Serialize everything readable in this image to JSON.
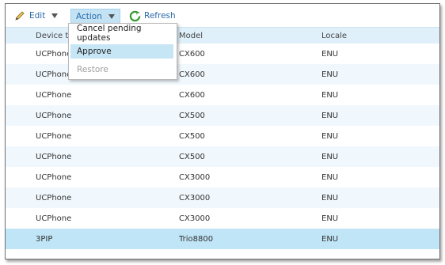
{
  "toolbar": {
    "edit_label": "Edit",
    "action_label": "Action",
    "refresh_label": "Refresh"
  },
  "menu": {
    "items": [
      {
        "label": "Cancel pending updates",
        "state": "normal"
      },
      {
        "label": "Approve",
        "state": "hover"
      },
      {
        "label": "Restore",
        "state": "disabled"
      }
    ]
  },
  "table": {
    "columns": [
      "Device type",
      "Model",
      "Locale"
    ],
    "rows": [
      {
        "device": "UCPhone",
        "model": "CX600",
        "locale": "ENU"
      },
      {
        "device": "UCPhone",
        "model": "CX600",
        "locale": "ENU"
      },
      {
        "device": "UCPhone",
        "model": "CX600",
        "locale": "ENU"
      },
      {
        "device": "UCPhone",
        "model": "CX500",
        "locale": "ENU"
      },
      {
        "device": "UCPhone",
        "model": "CX500",
        "locale": "ENU"
      },
      {
        "device": "UCPhone",
        "model": "CX500",
        "locale": "ENU"
      },
      {
        "device": "UCPhone",
        "model": "CX3000",
        "locale": "ENU"
      },
      {
        "device": "UCPhone",
        "model": "CX3000",
        "locale": "ENU"
      },
      {
        "device": "UCPhone",
        "model": "CX3000",
        "locale": "ENU"
      },
      {
        "device": "3PIP",
        "model": "Trio8800",
        "locale": "ENU"
      }
    ],
    "selected_row": 9
  },
  "colors": {
    "link": "#2b6aa8",
    "header_bg": "#dff0fb",
    "selected_bg": "#bfe5f6",
    "menu_hover_bg": "#c6e6f5"
  }
}
